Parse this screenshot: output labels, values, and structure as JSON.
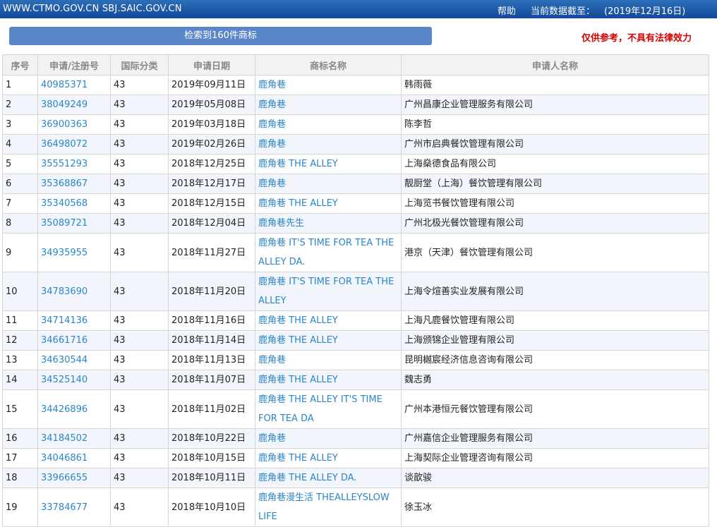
{
  "header": {
    "sites": "WWW.CTMO.GOV.CN SBJ.SAIC.GOV.CN",
    "help": "帮助",
    "date_label": "当前数据截至：",
    "date_value": "(2019年12月16日)"
  },
  "result_count": "检索到160件商标",
  "disclaimer": "仅供参考，不具有法律效力",
  "table": {
    "headers": [
      "序号",
      "申请/注册号",
      "国际分类",
      "申请日期",
      "商标名称",
      "申请人名称"
    ],
    "rows": [
      {
        "no": "1",
        "reg": "40985371",
        "cls": "43",
        "date": "2019年09月11日",
        "mark": "鹿角巷",
        "applicant": "韩雨薇"
      },
      {
        "no": "2",
        "reg": "38049249",
        "cls": "43",
        "date": "2019年05月08日",
        "mark": "鹿角巷",
        "applicant": "广州昌康企业管理服务有限公司"
      },
      {
        "no": "3",
        "reg": "36900363",
        "cls": "43",
        "date": "2019年03月18日",
        "mark": "鹿角巷",
        "applicant": "陈李哲"
      },
      {
        "no": "4",
        "reg": "36498072",
        "cls": "43",
        "date": "2019年02月26日",
        "mark": "鹿角巷",
        "applicant": "广州市启典餐饮管理有限公司"
      },
      {
        "no": "5",
        "reg": "35551293",
        "cls": "43",
        "date": "2018年12月25日",
        "mark": "鹿角巷 THE ALLEY",
        "applicant": "上海燊德食品有限公司"
      },
      {
        "no": "6",
        "reg": "35368867",
        "cls": "43",
        "date": "2018年12月17日",
        "mark": "鹿角巷",
        "applicant": "靓厨堂（上海）餐饮管理有限公司"
      },
      {
        "no": "7",
        "reg": "35340568",
        "cls": "43",
        "date": "2018年12月15日",
        "mark": "鹿角巷 THE ALLEY",
        "applicant": "上海览书餐饮管理有限公司"
      },
      {
        "no": "8",
        "reg": "35089721",
        "cls": "43",
        "date": "2018年12月04日",
        "mark": "鹿角巷先生",
        "applicant": "广州北极光餐饮管理有限公司"
      },
      {
        "no": "9",
        "reg": "34935955",
        "cls": "43",
        "date": "2018年11月27日",
        "mark": "鹿角巷 IT'S TIME FOR TEA THE ALLEY DA.",
        "applicant": "港京（天津）餐饮管理有限公司"
      },
      {
        "no": "10",
        "reg": "34783690",
        "cls": "43",
        "date": "2018年11月20日",
        "mark": "鹿角巷 IT'S TIME FOR TEA THE ALLEY",
        "applicant": "上海令煊善实业发展有限公司"
      },
      {
        "no": "11",
        "reg": "34714136",
        "cls": "43",
        "date": "2018年11月16日",
        "mark": "鹿角巷 THE ALLEY",
        "applicant": "上海凡鹿餐饮管理有限公司"
      },
      {
        "no": "12",
        "reg": "34661716",
        "cls": "43",
        "date": "2018年11月14日",
        "mark": "鹿角巷 THE ALLEY",
        "applicant": "上海颁锦企业管理有限公司"
      },
      {
        "no": "13",
        "reg": "34630544",
        "cls": "43",
        "date": "2018年11月13日",
        "mark": "鹿角巷",
        "applicant": "昆明樾宸经济信息咨询有限公司"
      },
      {
        "no": "14",
        "reg": "34525140",
        "cls": "43",
        "date": "2018年11月07日",
        "mark": "鹿角巷 THE ALLEY",
        "applicant": "魏志勇"
      },
      {
        "no": "15",
        "reg": "34426896",
        "cls": "43",
        "date": "2018年11月02日",
        "mark": "鹿角巷 THE ALLEY IT'S TIME FOR TEA DA",
        "applicant": "广州本港恒元餐饮管理有限公司"
      },
      {
        "no": "16",
        "reg": "34184502",
        "cls": "43",
        "date": "2018年10月22日",
        "mark": "鹿角巷",
        "applicant": "广州嘉信企业管理服务有限公司"
      },
      {
        "no": "17",
        "reg": "34046861",
        "cls": "43",
        "date": "2018年10月15日",
        "mark": "鹿角巷 THE ALLEY",
        "applicant": "上海契际企业管理咨询有限公司"
      },
      {
        "no": "18",
        "reg": "33966655",
        "cls": "43",
        "date": "2018年10月11日",
        "mark": "鹿角巷 THE ALLEY DA.",
        "applicant": "谈歆骏"
      },
      {
        "no": "19",
        "reg": "33784677",
        "cls": "43",
        "date": "2018年10月10日",
        "mark": "鹿角巷漫生活 THEALLEYSLOW LIFE",
        "applicant": "徐玉冰"
      }
    ]
  }
}
